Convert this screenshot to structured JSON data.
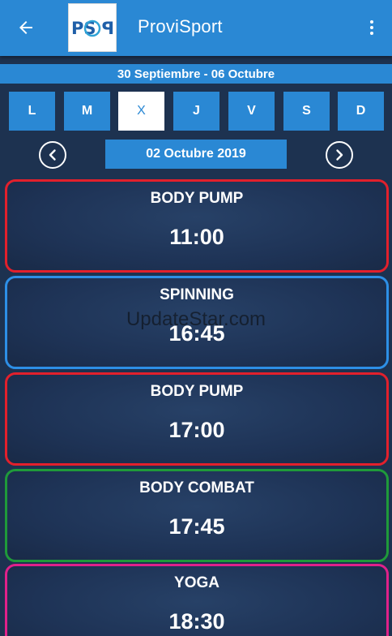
{
  "appbar": {
    "title": "ProviSport",
    "logo_text": "PSP"
  },
  "week": {
    "range": "30 Septiembre - 06 Octubre"
  },
  "days": [
    {
      "label": "L",
      "selected": false
    },
    {
      "label": "M",
      "selected": false
    },
    {
      "label": "X",
      "selected": true
    },
    {
      "label": "J",
      "selected": false
    },
    {
      "label": "V",
      "selected": false
    },
    {
      "label": "S",
      "selected": false
    },
    {
      "label": "D",
      "selected": false
    }
  ],
  "date_selector": {
    "current": "02 Octubre 2019"
  },
  "classes": [
    {
      "name": "BODY PUMP",
      "time": "11:00",
      "color": "#e2202c"
    },
    {
      "name": "SPINNING",
      "time": "16:45",
      "color": "#2d8fe6"
    },
    {
      "name": "BODY PUMP",
      "time": "17:00",
      "color": "#e2202c"
    },
    {
      "name": "BODY COMBAT",
      "time": "17:45",
      "color": "#1f9a3a"
    },
    {
      "name": "YOGA",
      "time": "18:30",
      "color": "#e0218a"
    }
  ],
  "watermark": "UpdateStar.com",
  "colors": {
    "primary": "#2a88d4",
    "background": "#1d3250"
  },
  "icons": {
    "back": "arrow-left-icon",
    "menu": "more-vert-icon",
    "prev": "chevron-left-icon",
    "next": "chevron-right-icon"
  }
}
